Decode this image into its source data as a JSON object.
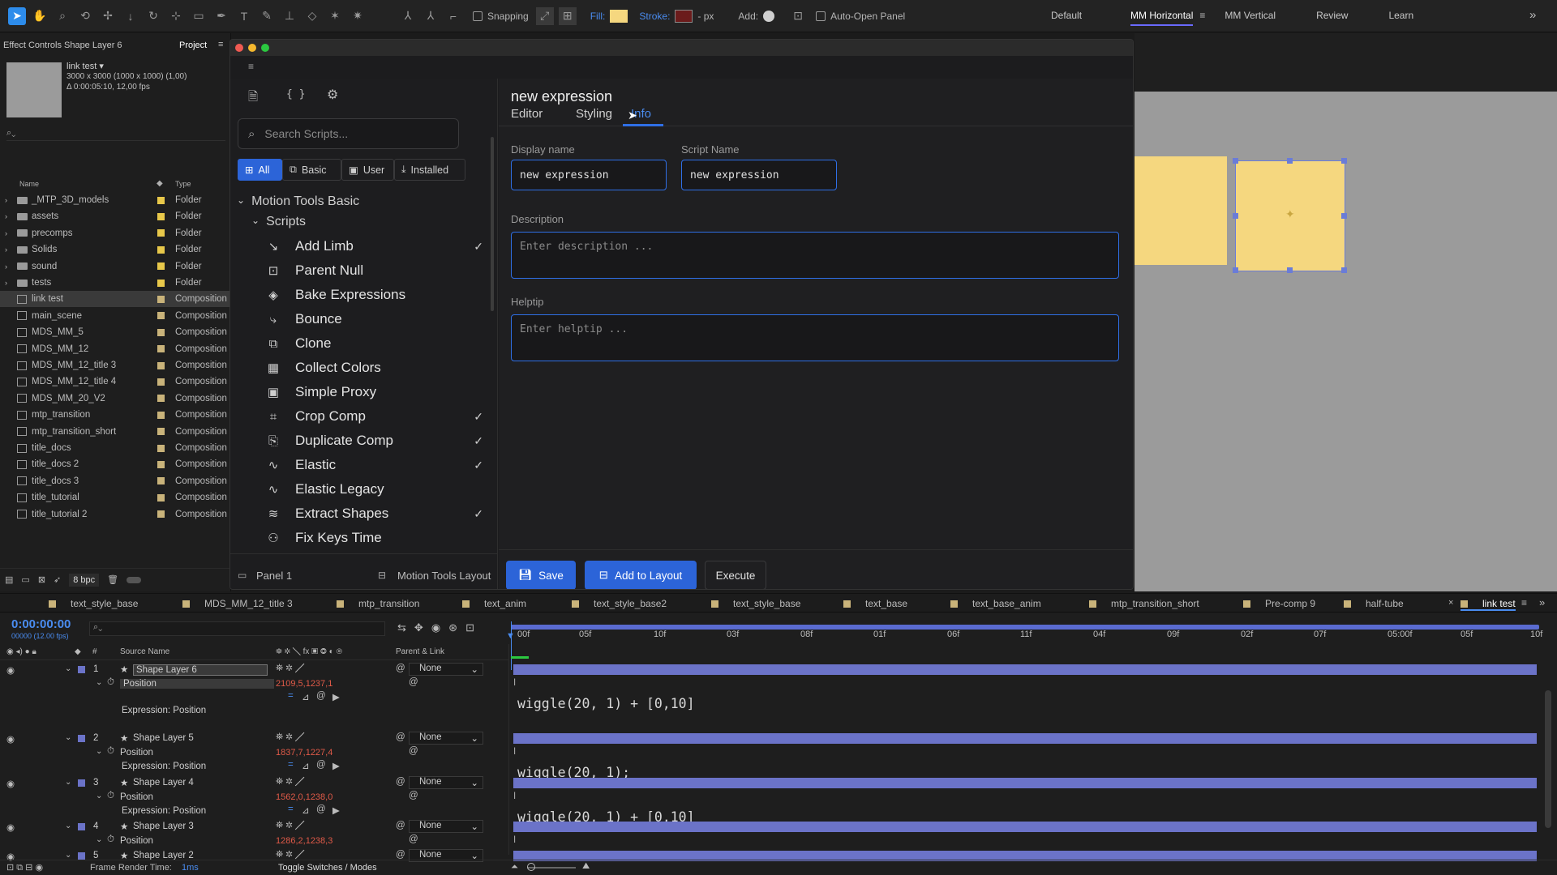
{
  "toolbar": {
    "snapping": "Snapping",
    "fill": "Fill:",
    "stroke": "Stroke:",
    "px": "- px",
    "add": "Add:",
    "auto_open": "Auto-Open Panel",
    "workspaces": [
      "Default",
      "MM Horizontal",
      "MM Vertical",
      "Review",
      "Learn"
    ],
    "active_workspace": "MM Horizontal"
  },
  "project_panel": {
    "effect_controls_tab": "Effect Controls Shape Layer 6",
    "project_tab": "Project",
    "comp_name": "link test",
    "comp_info_1": "3000 x 3000  (1000 x 1000) (1,00)",
    "comp_info_2": "Δ 0:00:05:10, 12,00 fps",
    "col_name": "Name",
    "col_type": "Type",
    "items": [
      {
        "name": "_MTP_3D_models",
        "type": "Folder",
        "kind": "folder",
        "color": "#e8c84a"
      },
      {
        "name": "assets",
        "type": "Folder",
        "kind": "folder",
        "color": "#e8c84a"
      },
      {
        "name": "precomps",
        "type": "Folder",
        "kind": "folder",
        "color": "#e8c84a"
      },
      {
        "name": "Solids",
        "type": "Folder",
        "kind": "folder",
        "color": "#e8c84a"
      },
      {
        "name": "sound",
        "type": "Folder",
        "kind": "folder",
        "color": "#e8c84a"
      },
      {
        "name": "tests",
        "type": "Folder",
        "kind": "folder",
        "color": "#e8c84a"
      },
      {
        "name": "link test",
        "type": "Composition",
        "kind": "comp",
        "color": "#c9b37a",
        "selected": true
      },
      {
        "name": "main_scene",
        "type": "Composition",
        "kind": "comp",
        "color": "#c9b37a"
      },
      {
        "name": "MDS_MM_5",
        "type": "Composition",
        "kind": "comp",
        "color": "#c9b37a"
      },
      {
        "name": "MDS_MM_12",
        "type": "Composition",
        "kind": "comp",
        "color": "#c9b37a"
      },
      {
        "name": "MDS_MM_12_title 3",
        "type": "Composition",
        "kind": "comp",
        "color": "#c9b37a"
      },
      {
        "name": "MDS_MM_12_title 4",
        "type": "Composition",
        "kind": "comp",
        "color": "#c9b37a"
      },
      {
        "name": "MDS_MM_20_V2",
        "type": "Composition",
        "kind": "comp",
        "color": "#c9b37a"
      },
      {
        "name": "mtp_transition",
        "type": "Composition",
        "kind": "comp",
        "color": "#c9b37a"
      },
      {
        "name": "mtp_transition_short",
        "type": "Composition",
        "kind": "comp",
        "color": "#c9b37a"
      },
      {
        "name": "title_docs",
        "type": "Composition",
        "kind": "comp",
        "color": "#c9b37a"
      },
      {
        "name": "title_docs 2",
        "type": "Composition",
        "kind": "comp",
        "color": "#c9b37a"
      },
      {
        "name": "title_docs 3",
        "type": "Composition",
        "kind": "comp",
        "color": "#c9b37a"
      },
      {
        "name": "title_tutorial",
        "type": "Composition",
        "kind": "comp",
        "color": "#c9b37a"
      },
      {
        "name": "title_tutorial 2",
        "type": "Composition",
        "kind": "comp",
        "color": "#c9b37a"
      }
    ],
    "bpc": "8 bpc"
  },
  "modal": {
    "search_placeholder": "Search Scripts...",
    "filters": [
      "All",
      "Basic",
      "User",
      "Installed"
    ],
    "group_title": "Motion Tools Basic",
    "subgroup_title": "Scripts",
    "scripts": [
      {
        "label": "Add Limb",
        "icon": "add-limb-icon",
        "glyph": "↘",
        "checked": true
      },
      {
        "label": "Parent Null",
        "icon": "parent-null-icon",
        "glyph": "⊡",
        "checked": false
      },
      {
        "label": "Bake Expressions",
        "icon": "bake-expressions-icon",
        "glyph": "◈",
        "checked": false
      },
      {
        "label": "Bounce",
        "icon": "bounce-icon",
        "glyph": "⤷",
        "checked": false
      },
      {
        "label": "Clone",
        "icon": "clone-icon",
        "glyph": "⧉",
        "checked": false
      },
      {
        "label": "Collect Colors",
        "icon": "collect-colors-icon",
        "glyph": "▦",
        "checked": false
      },
      {
        "label": "Simple Proxy",
        "icon": "simple-proxy-icon",
        "glyph": "▣",
        "checked": false
      },
      {
        "label": "Crop Comp",
        "icon": "crop-comp-icon",
        "glyph": "⌗",
        "checked": true
      },
      {
        "label": "Duplicate Comp",
        "icon": "duplicate-comp-icon",
        "glyph": "⎘",
        "checked": true
      },
      {
        "label": "Elastic",
        "icon": "elastic-icon",
        "glyph": "∿",
        "checked": true
      },
      {
        "label": "Elastic Legacy",
        "icon": "elastic-legacy-icon",
        "glyph": "∿",
        "checked": false
      },
      {
        "label": "Extract Shapes",
        "icon": "extract-shapes-icon",
        "glyph": "≋",
        "checked": true
      },
      {
        "label": "Fix Keys Time",
        "icon": "fix-keys-time-icon",
        "glyph": "⚇",
        "checked": false
      }
    ],
    "footer_panel": "Panel 1",
    "footer_layout": "Motion Tools Layout",
    "title": "new expression",
    "tabs": [
      "Editor",
      "Styling",
      "Info"
    ],
    "active_tab": "Info",
    "display_name_label": "Display name",
    "display_name_value": "new expression",
    "script_name_label": "Script Name",
    "script_name_value": "new expression",
    "description_label": "Description",
    "description_placeholder": "Enter description ...",
    "helptip_label": "Helptip",
    "helptip_placeholder": "Enter helptip ...",
    "save": "Save",
    "add_to_layout": "Add to Layout",
    "execute": "Execute"
  },
  "viewer": {
    "square_color": "#f5d77f",
    "bg_color": "#9b9b9b"
  },
  "timeline": {
    "tabs": [
      "text_style_base",
      "MDS_MM_12_title 3",
      "mtp_transition",
      "text_anim",
      "text_style_base2",
      "text_style_base",
      "text_base",
      "text_base_anim",
      "mtp_transition_short",
      "Pre-comp 9",
      "half-tube",
      "link test"
    ],
    "active_tab": "link test",
    "timecode": "0:00:00:00",
    "fps_info": "00000 (12.00 fps)",
    "col_source": "Source Name",
    "col_parent": "Parent & Link",
    "ruler": [
      "00f",
      "05f",
      "10f",
      "03f",
      "08f",
      "01f",
      "06f",
      "11f",
      "04f",
      "09f",
      "02f",
      "07f",
      "05:00f",
      "05f",
      "10f"
    ],
    "layers": [
      {
        "num": "1",
        "name": "Shape Layer 6",
        "prop": "Position",
        "value": "2109,5,1237,1",
        "parent": "None",
        "expr_label": "Expression: Position",
        "expr": "wiggle(20, 1) + [0,10]"
      },
      {
        "num": "2",
        "name": "Shape Layer 5",
        "prop": "Position",
        "value": "1837,7,1227,4",
        "parent": "None",
        "expr_label": "Expression: Position",
        "expr": "wiggle(20, 1);"
      },
      {
        "num": "3",
        "name": "Shape Layer 4",
        "prop": "Position",
        "value": "1562,0,1238,0",
        "parent": "None",
        "expr_label": "Expression: Position",
        "expr": "wiggle(20, 1) + [0,10]"
      },
      {
        "num": "4",
        "name": "Shape Layer 3",
        "prop": "Position",
        "value": "1286,2,1238,3",
        "parent": "None"
      },
      {
        "num": "5",
        "name": "Shape Layer 2",
        "parent": "None"
      }
    ],
    "render_time_label": "Frame Render Time:",
    "render_time_value": "1ms",
    "toggle_label": "Toggle Switches / Modes"
  }
}
